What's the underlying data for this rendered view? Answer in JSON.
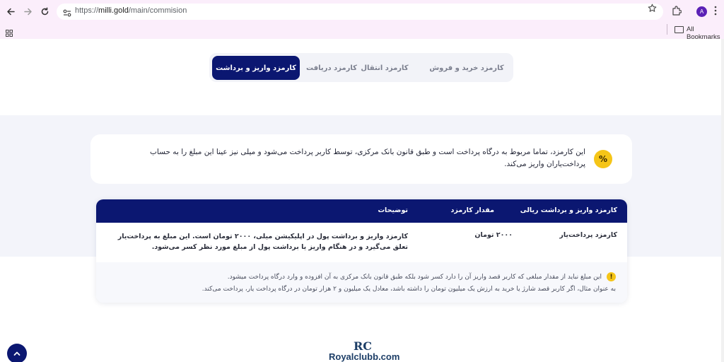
{
  "browser": {
    "url": "https://milli.gold/main/commision",
    "url_scheme": "https://",
    "url_host": "milli.gold",
    "url_path": "/main/commision",
    "avatar_letter": "A",
    "bookmarks_label": "All Bookmarks"
  },
  "tabs": [
    {
      "label": "کارمزد خرید و فروش",
      "active": false
    },
    {
      "label": "کارمزد انتقال",
      "active": false
    },
    {
      "label": "کارمزد دریافت",
      "active": false
    },
    {
      "label": "کارمزد واریز و برداشت",
      "active": true
    }
  ],
  "info": {
    "badge": "%",
    "text": "این کارمزد، تماما مربوط به درگاه پرداخت است و طبق قانون بانک مرکزی، توسط کاربر پرداخت می‌شود و میلی نیز عینا این مبلغ را به حساب پرداخت‌یاران واریز می‌کند."
  },
  "table": {
    "headers": {
      "name": "کارمزد واریز و برداشت ریالی",
      "amount": "مقدار کارمزد",
      "desc": "توضیحات"
    },
    "rows": [
      {
        "name": "کارمزد پرداخت‌یار",
        "amount": "۲۰۰۰ تومان",
        "desc": "کارمزد واریز و برداشت پول در اپلیکیشن میلی، ۲۰۰۰ تومان است. این مبلغ به پرداخت‌یار تعلق می‌گیرد و در هنگام واریز یا برداشت پول از مبلغ مورد نظر کسر می‌شود."
      }
    ],
    "note": {
      "icon": "!",
      "line1": "این مبلغ نباید از مقدار مبلغی که کاربر قصد واریز آن را دارد کسر شود بلکه طبق قانون بانک مرکزی به آن افزوده و وارد درگاه پرداخت میشود.",
      "line2": "به عنوان مثال، اگر کاربر قصد شارژ یا خرید به ارزش یک میلیون تومان را داشته باشد، معادل یک میلیون و ۲ هزار تومان در درگاه پرداخت یار، پرداخت می‌کند."
    }
  },
  "watermark": {
    "logo": "RC",
    "text": "Royalclubb.com"
  },
  "colors": {
    "navy": "#0b1771",
    "accent_yellow": "#f5c518",
    "band": "#f3f4fa",
    "chrome": "#fbeefb"
  }
}
